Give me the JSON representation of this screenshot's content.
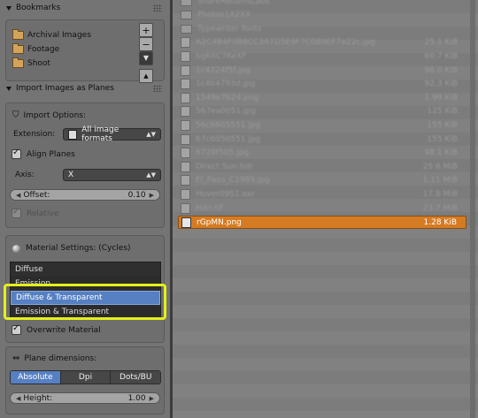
{
  "bookmarks": {
    "title": "Bookmarks",
    "items": [
      {
        "label": "Archival Images"
      },
      {
        "label": "Footage"
      },
      {
        "label": "Shoot"
      }
    ],
    "add_label": "+",
    "remove_label": "−",
    "menu_label": "▼",
    "collapse_label": "▲"
  },
  "import_panel": {
    "title": "Import Images as Planes",
    "import_options": "Import Options:",
    "extension_label": "Extension:",
    "extension_value": "All image formats",
    "align_planes": {
      "label": "Align Planes",
      "checked": true
    },
    "axis_label": "Axis:",
    "axis_value": "X",
    "offset_label": "Offset:",
    "offset_value": "0.10",
    "relative": {
      "label": "Relative",
      "checked": true,
      "enabled": false
    }
  },
  "material": {
    "title": "Material Settings: (Cycles)",
    "options": [
      {
        "label": "Diffuse",
        "selected": false
      },
      {
        "label": "Emission",
        "selected": false
      },
      {
        "label": "Diffuse & Transparent",
        "selected": true
      },
      {
        "label": "Emission & Transparent",
        "selected": false
      }
    ],
    "overwrite": {
      "label": "Overwrite Material",
      "checked": true
    }
  },
  "plane_dimensions": {
    "title": "Plane dimensions:",
    "modes": [
      {
        "label": "Absolute",
        "active": true
      },
      {
        "label": "Dpi",
        "active": false
      },
      {
        "label": "Dots/BU",
        "active": false
      }
    ],
    "height_label": "Height:",
    "height_value": "1.00"
  },
  "files": {
    "rows": [
      {
        "name": "ShareReturnsLabs",
        "size": "",
        "type": "folder"
      },
      {
        "name": "Photos1X2XX",
        "size": "",
        "type": "folder"
      },
      {
        "name": "Typewriter fonts",
        "size": "",
        "type": "folder"
      },
      {
        "name": "A2C4B4F0B8CC3A7D5E9F7C0B9EF7a22c.jpg",
        "size": "25.1 KiB",
        "type": "file"
      },
      {
        "name": "bgK6C7KeXF",
        "size": "60.7 KiB",
        "type": "file"
      },
      {
        "name": "1c4224f5f.jpg",
        "size": "96.0 KiB",
        "type": "file"
      },
      {
        "name": "1c4b4793d.jpg",
        "size": "92.3 KiB",
        "type": "file"
      },
      {
        "name": "1549e7624.png",
        "size": "1.99 KiB",
        "type": "file"
      },
      {
        "name": "567ea0051.jpg",
        "size": "125 KiB",
        "type": "file"
      },
      {
        "name": "56c6605551.jpg",
        "size": "155 KiB",
        "type": "file"
      },
      {
        "name": "67c6050551.jpg",
        "size": "155 KiB",
        "type": "file"
      },
      {
        "name": "6729f505.jpg",
        "size": "98.1 KiB",
        "type": "file"
      },
      {
        "name": "Direct Sun.hdr",
        "size": "25.6 MiB",
        "type": "file"
      },
      {
        "name": "El_Paso_C1989.jpg",
        "size": "1.11 MiB",
        "type": "file"
      },
      {
        "name": "Hover09S1.exr",
        "size": "17.8 MiB",
        "type": "file"
      },
      {
        "name": "Hdri.tif",
        "size": "23.7 MiB",
        "type": "file"
      },
      {
        "name": "rGpMN.png",
        "size": "1.28 KiB",
        "type": "file",
        "selected": true
      }
    ]
  },
  "colors": {
    "panel_bg": "#747474",
    "browser_bg": "#7c7c7c",
    "selection_blue": "#5680c2",
    "selection_orange": "#d47b23",
    "highlight_yellow": "#e2f01a"
  }
}
